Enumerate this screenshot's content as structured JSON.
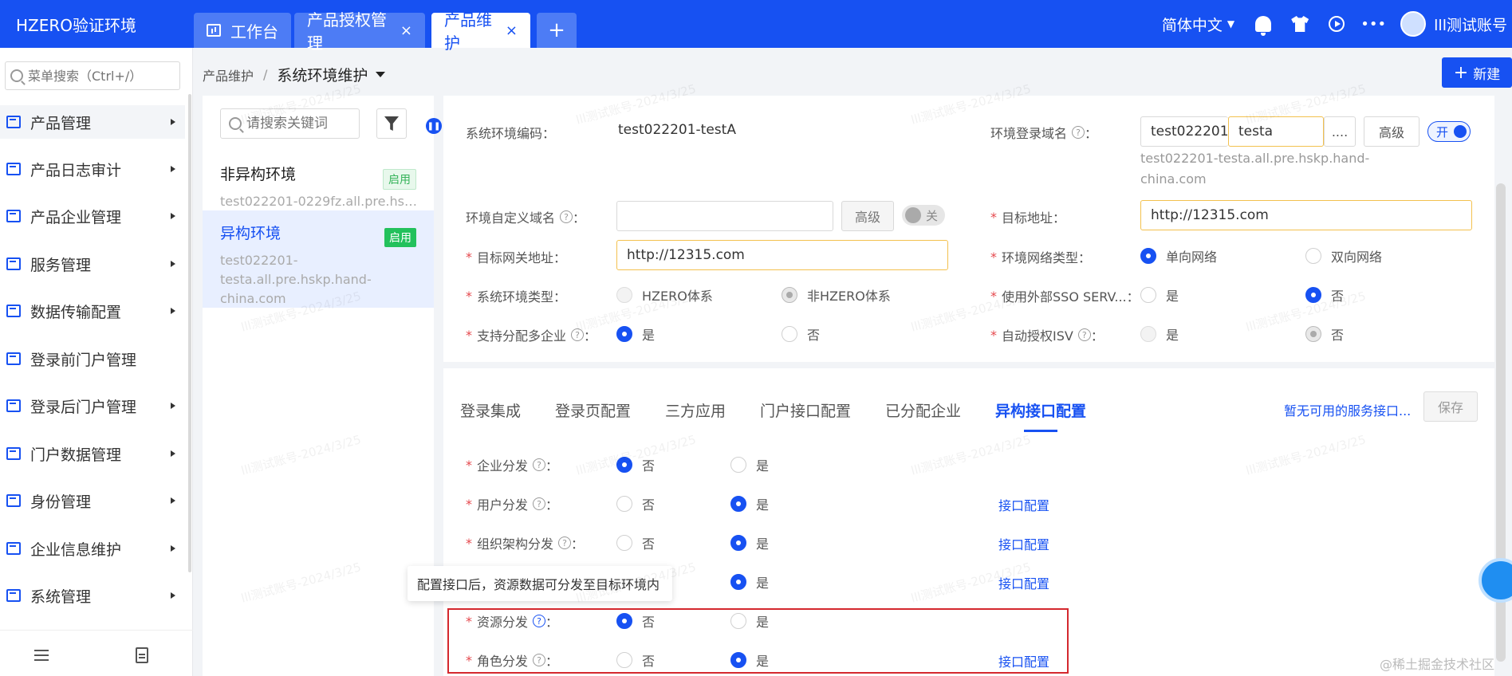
{
  "topbar": {
    "brand": "HZERO验证环境",
    "tabs": [
      {
        "label": "工作台",
        "closable": false,
        "active": false
      },
      {
        "label": "产品授权管理",
        "closable": true,
        "active": false
      },
      {
        "label": "产品维护",
        "closable": true,
        "active": true
      }
    ],
    "add_tab": "+",
    "close_glyph": "×",
    "language": "简体中文",
    "user": "lll测试账号"
  },
  "sidebar": {
    "search_placeholder": "菜单搜索（Ctrl+/）",
    "items": [
      {
        "label": "产品管理",
        "has_children": true,
        "highlighted": true
      },
      {
        "label": "产品日志审计",
        "has_children": true
      },
      {
        "label": "产品企业管理",
        "has_children": true
      },
      {
        "label": "服务管理",
        "has_children": true
      },
      {
        "label": "数据传输配置",
        "has_children": true
      },
      {
        "label": "登录前门户管理",
        "has_children": false
      },
      {
        "label": "登录后门户管理",
        "has_children": true
      },
      {
        "label": "门户数据管理",
        "has_children": true
      },
      {
        "label": "身份管理",
        "has_children": true
      },
      {
        "label": "企业信息维护",
        "has_children": true
      },
      {
        "label": "系统管理",
        "has_children": true
      }
    ]
  },
  "breadcrumb": {
    "parent": "产品维护",
    "separator": "/",
    "current": "系统环境维护"
  },
  "new_button": {
    "plus": "+",
    "label": "新建"
  },
  "env_list": {
    "search_placeholder": "请搜索关键词",
    "items": [
      {
        "name": "非异构环境",
        "status": "启用",
        "domain": "test022201-0229fz.all.pre.hskp....",
        "selected": false
      },
      {
        "name": "异构环境",
        "status": "启用",
        "domain": "test022201-testa.all.pre.hskp.hand-china.com",
        "selected": true
      }
    ]
  },
  "form": {
    "code_label": "系统环境编码",
    "code_value": "test022201-testA",
    "login_domain_label": "环境登录域名",
    "login_domain_prefix": "test022201-",
    "login_domain_input": "testa",
    "more": "....",
    "advanced": "高级",
    "login_domain_switch": "开",
    "login_domain_hint": "test022201-testa.all.pre.hskp.hand-china.com",
    "custom_domain_label": "环境自定义域名",
    "custom_domain_switch": "关",
    "target_address_label": "目标地址",
    "target_address_value": "http://12315.com",
    "gateway_label": "目标网关地址",
    "gateway_value": "http://12315.com",
    "network_type_label": "环境网络类型",
    "network_options": [
      "单向网络",
      "双向网络"
    ],
    "sys_env_type_label": "系统环境类型",
    "sys_env_options": [
      "HZERO体系",
      "非HZERO体系"
    ],
    "external_sso_label": "使用外部SSO SERV...",
    "multi_enterprise_label": "支持分配多企业",
    "auto_isv_label": "自动授权ISV",
    "yes": "是",
    "no": "否",
    "colon": "："
  },
  "config": {
    "tabs": [
      "登录集成",
      "登录页配置",
      "三方应用",
      "门户接口配置",
      "已分配企业",
      "异构接口配置"
    ],
    "active_tab": "异构接口配置",
    "service_link": "暂无可用的服务接口...",
    "save": "保存",
    "rows": [
      {
        "label": "企业分发",
        "selected": "否",
        "link": ""
      },
      {
        "label": "用户分发",
        "selected": "是",
        "link": "接口配置"
      },
      {
        "label": "组织架构分发",
        "selected": "是",
        "link": "接口配置"
      },
      {
        "label": "",
        "selected": "是",
        "link": "接口配置"
      },
      {
        "label": "资源分发",
        "selected": "否",
        "link": ""
      },
      {
        "label": "角色分发",
        "selected": "是",
        "link": "接口配置"
      }
    ],
    "tooltip": "配置接口后，资源数据可分发至目标环境内"
  },
  "credit": "@稀土掘金技术社区",
  "watermark": "lll测试账号-2024/3/25"
}
